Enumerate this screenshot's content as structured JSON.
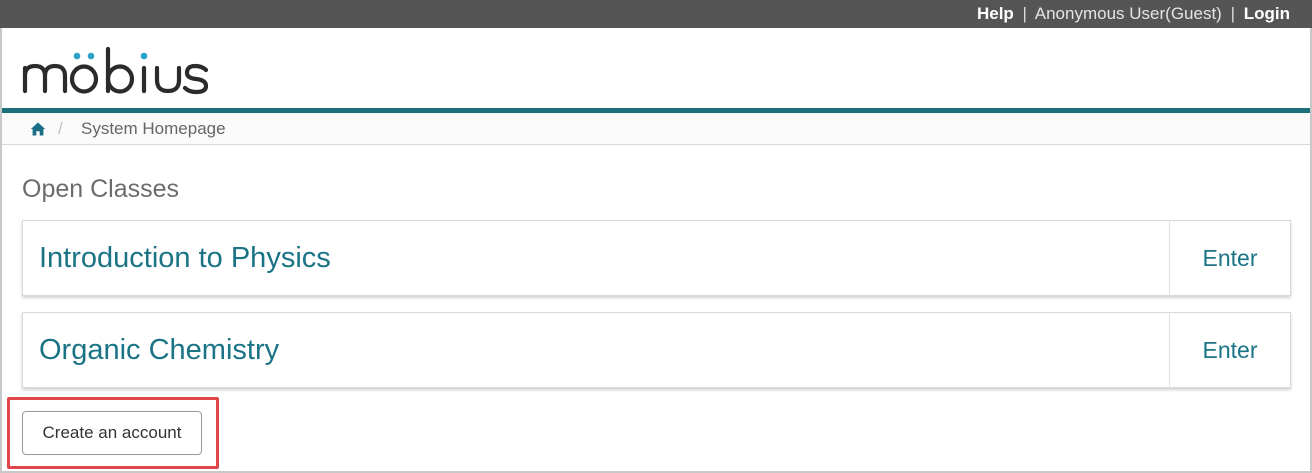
{
  "topbar": {
    "help_label": "Help",
    "separator": "|",
    "user_label": "Anonymous User(Guest)",
    "login_label": "Login"
  },
  "logo": {
    "text": "möbius",
    "colors": {
      "letters": "#2b2b2b",
      "accent": "#2ba3c8"
    }
  },
  "breadcrumb": {
    "home_icon": "home-icon",
    "separator": "/",
    "current": "System Homepage"
  },
  "main": {
    "section_title": "Open Classes",
    "classes": [
      {
        "name": "Introduction to Physics",
        "action_label": "Enter"
      },
      {
        "name": "Organic Chemistry",
        "action_label": "Enter"
      }
    ],
    "create_account_label": "Create an account"
  },
  "colors": {
    "topbar_bg": "#555555",
    "brand_rule": "#1b6f7a",
    "link": "#1a7486",
    "highlight": "#e0474c"
  }
}
